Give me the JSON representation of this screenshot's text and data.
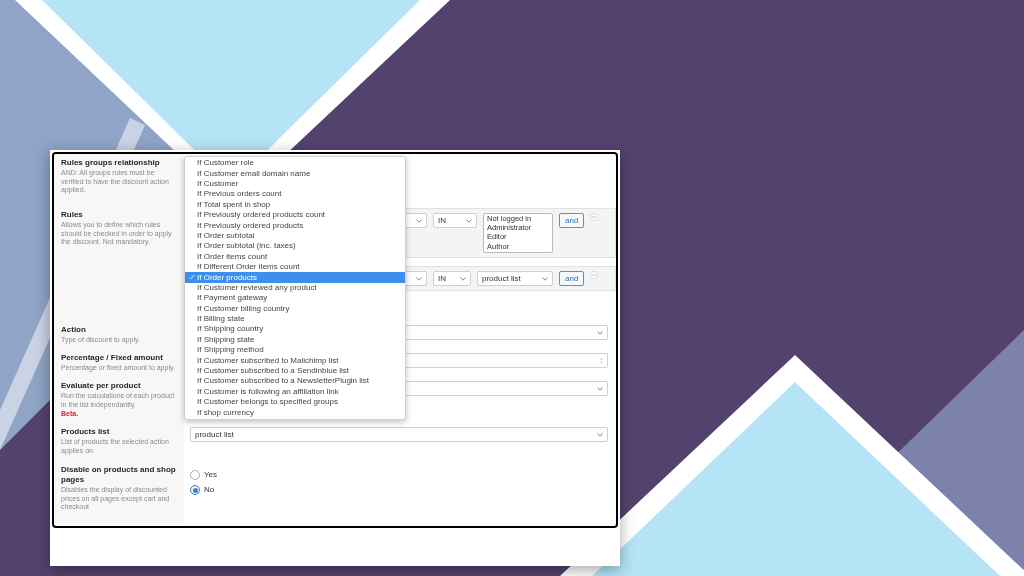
{
  "settings": [
    {
      "kind": "blank",
      "label": "Rules groups relationship",
      "description": "AND: All groups rules must be verified to have the discount action applied."
    },
    {
      "kind": "rules",
      "label": "Rules",
      "description": "Allows you to define which rules should be checked in order to apply the discount. Not mandatory.",
      "rules": [
        {
          "kind": "listbox",
          "operator": "IN",
          "options": [
            "Not logged in",
            "Administrator",
            "Editor",
            "Author"
          ],
          "button": "and"
        },
        {
          "kind": "select",
          "operator": "IN",
          "value": "product list",
          "button": "and"
        }
      ]
    },
    {
      "kind": "select",
      "label": "Action",
      "description": "Type of discount to apply."
    },
    {
      "kind": "number",
      "label": "Percentage / Fixed amount",
      "description": "Percentage or fixed amount to apply."
    },
    {
      "kind": "select",
      "label": "Evaluate per product",
      "description": "Run the calculations of each product in the list independantly.",
      "note": "Beta."
    },
    {
      "kind": "select",
      "label": "Products list",
      "description": "List of products the selected action applies on",
      "value": "product list"
    },
    {
      "kind": "radio",
      "label": "Disable on products and shop pages",
      "description": "Disables the display of discounted prices on all pages except cart and checkout",
      "options": [
        {
          "label": "Yes",
          "selected": false
        },
        {
          "label": "No",
          "selected": true
        }
      ]
    }
  ],
  "dropdown": {
    "items": [
      {
        "label": "If Customer role",
        "selected": false
      },
      {
        "label": "If Customer email domain name",
        "selected": false
      },
      {
        "label": "If Customer",
        "selected": false
      },
      {
        "label": "If Previous orders count",
        "selected": false
      },
      {
        "label": "If Total spent in shop",
        "selected": false
      },
      {
        "label": "If Previously ordered products count",
        "selected": false
      },
      {
        "label": "If Previously ordered products",
        "selected": false
      },
      {
        "label": "If Order subtotal",
        "selected": false
      },
      {
        "label": "If Order subtotal (inc. taxes)",
        "selected": false
      },
      {
        "label": "If Order items count",
        "selected": false
      },
      {
        "label": "If Different Order items count",
        "selected": false
      },
      {
        "label": "If Order products",
        "selected": true
      },
      {
        "label": "If Customer reviewed any product",
        "selected": false
      },
      {
        "label": "If Payment gateway",
        "selected": false
      },
      {
        "label": "If Customer billing country",
        "selected": false
      },
      {
        "label": "If Billing state",
        "selected": false
      },
      {
        "label": "If Shipping country",
        "selected": false
      },
      {
        "label": "If Shipping state",
        "selected": false
      },
      {
        "label": "If Shipping method",
        "selected": false
      },
      {
        "label": "If Customer subscribed to Mailchimp list",
        "selected": false
      },
      {
        "label": "If Customer subscribed to a Sendinblue list",
        "selected": false
      },
      {
        "label": "If Customer subscribed to a NewsletterPlugin list",
        "selected": false
      },
      {
        "label": "If Customer is following an affiliation link",
        "selected": false
      },
      {
        "label": "If Customer belongs to specified groups",
        "selected": false
      },
      {
        "label": "If shop currency",
        "selected": false
      }
    ]
  }
}
